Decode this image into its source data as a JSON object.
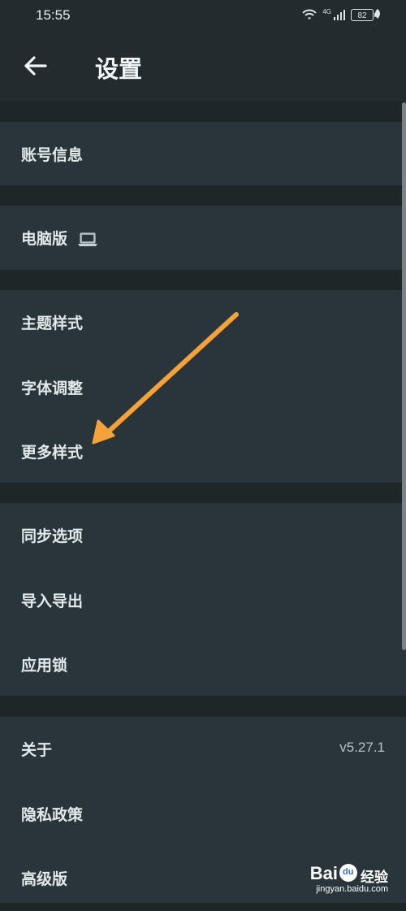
{
  "status_bar": {
    "time": "15:55",
    "network": "4G",
    "battery": "82"
  },
  "app_bar": {
    "title": "设置"
  },
  "groups": [
    {
      "items": [
        {
          "label": "账号信息"
        }
      ]
    },
    {
      "items": [
        {
          "label": "电脑版",
          "icon": "laptop-icon"
        }
      ]
    },
    {
      "items": [
        {
          "label": "主题样式"
        },
        {
          "label": "字体调整"
        },
        {
          "label": "更多样式"
        }
      ]
    },
    {
      "items": [
        {
          "label": "同步选项"
        },
        {
          "label": "导入导出"
        },
        {
          "label": "应用锁"
        }
      ]
    },
    {
      "items": [
        {
          "label": "关于",
          "value": "v5.27.1"
        },
        {
          "label": "隐私政策"
        },
        {
          "label": "高级版"
        }
      ]
    }
  ],
  "annotation": {
    "color": "#f5a23a",
    "points_to": "更多样式"
  },
  "watermark": {
    "brand": "Bai",
    "paw_text": "du",
    "text": "经验",
    "url": "jingyan.baidu.com"
  },
  "colors": {
    "background": "#1f2628",
    "group": "#29353a",
    "bar": "#232b2e",
    "text": "#e3e9ea"
  }
}
